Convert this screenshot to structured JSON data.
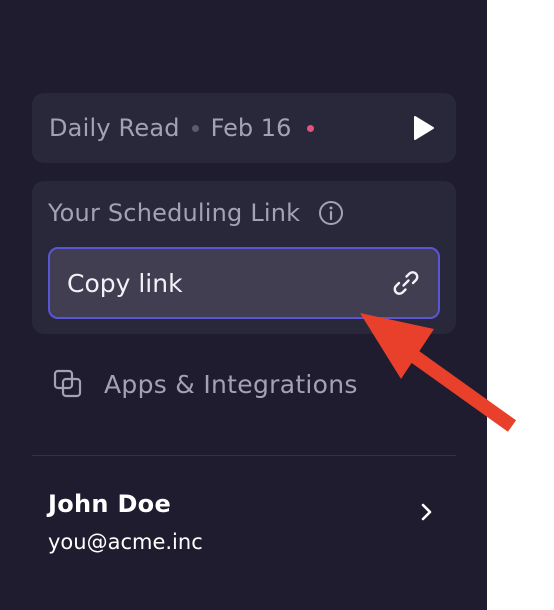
{
  "daily": {
    "title": "Daily Read",
    "date": "Feb 16"
  },
  "scheduling": {
    "title": "Your Scheduling Link",
    "copy_label": "Copy link"
  },
  "apps": {
    "label": "Apps & Integrations"
  },
  "user": {
    "name": "John Doe",
    "email": "you@acme.inc"
  },
  "colors": {
    "sidebar_bg": "#1e1c2e",
    "card_bg": "#29273a",
    "field_bg": "#403e50",
    "focus_border": "#5a55d6",
    "unread_dot": "#e0557a",
    "annotation_arrow": "#e8402b"
  },
  "icons": [
    "play-icon",
    "info-icon",
    "link-icon",
    "apps-icon",
    "chevron-right-icon",
    "annotation-arrow"
  ]
}
